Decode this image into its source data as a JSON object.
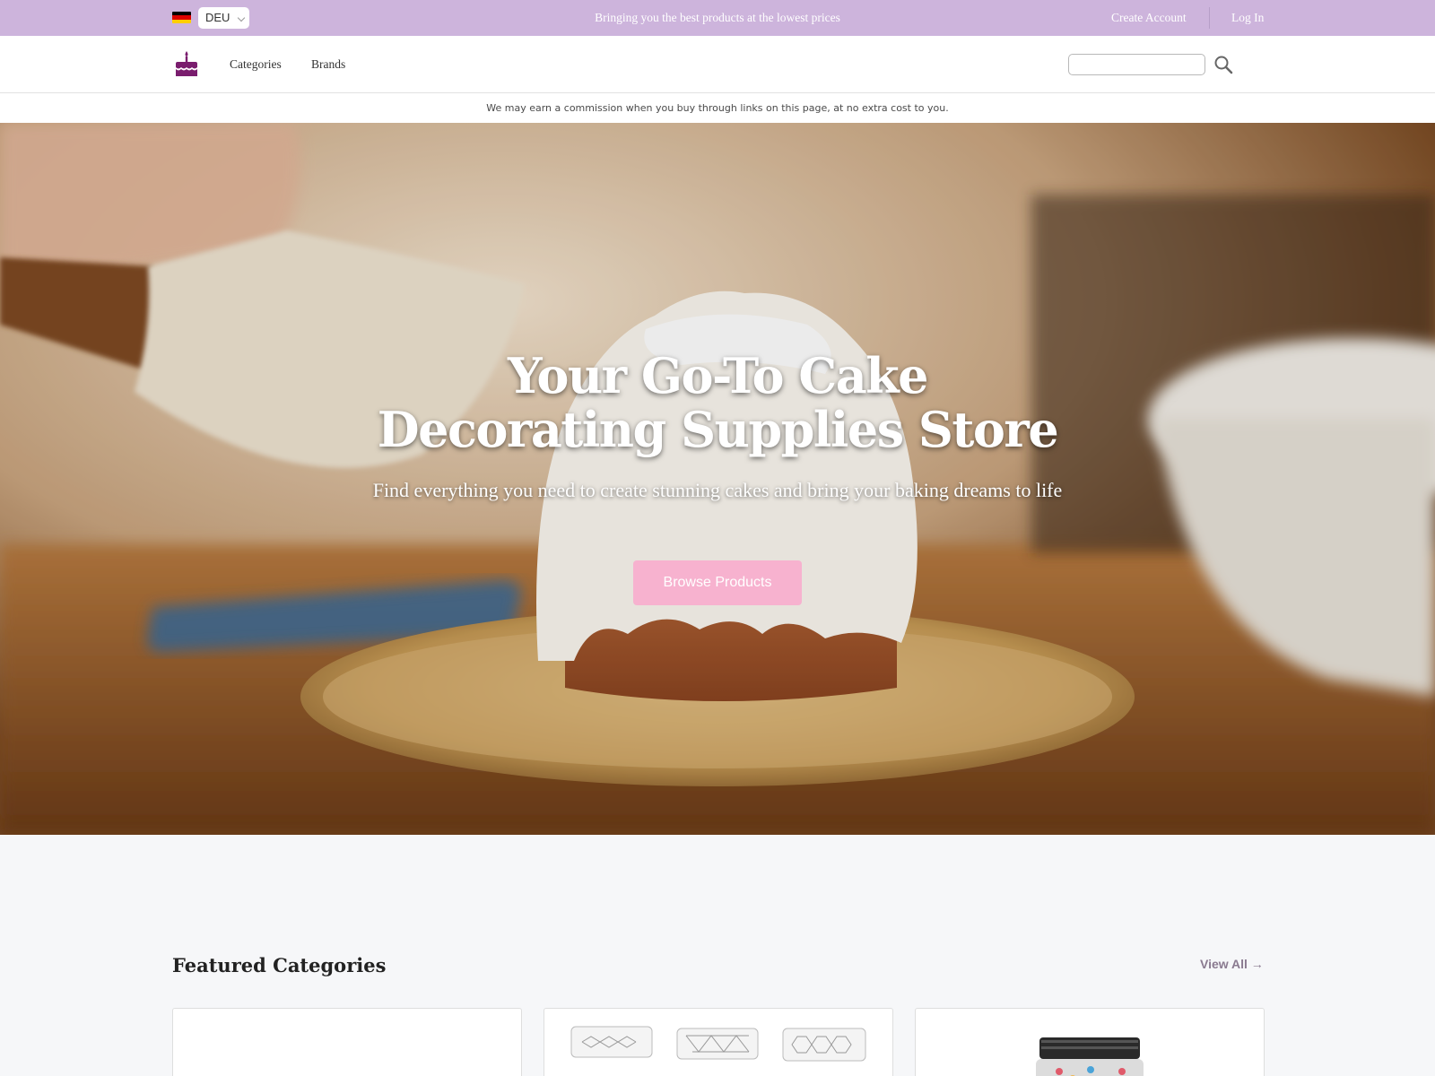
{
  "topbar": {
    "country_code": "DEU",
    "tagline": "Bringing you the best products at the lowest prices",
    "create_account": "Create Account",
    "login": "Log In",
    "background_color": "#cdb4dc"
  },
  "nav": {
    "logo_icon": "birthday-cake-icon",
    "links": [
      "Categories",
      "Brands"
    ],
    "search_placeholder": "",
    "search_icon": "search-icon"
  },
  "disclosure": "We may earn a commission when you buy through links on this page, at no extra cost to you.",
  "hero": {
    "title": "Your Go-To Cake Decorating Supplies Store",
    "subtitle": "Find everything you need to create stunning cakes and bring your baking dreams to life",
    "cta": "Browse Products",
    "cta_color": "#f7b2cf"
  },
  "featured": {
    "title": "Featured Categories",
    "view_all": "View All →"
  }
}
